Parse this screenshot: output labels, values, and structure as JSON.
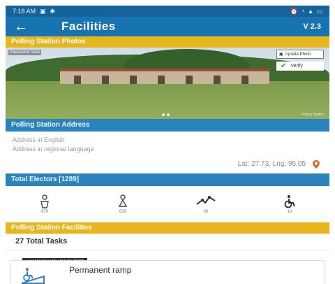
{
  "status_bar": {
    "time": "7:18 AM",
    "icons_left": [
      "sim-icon",
      "bluetooth-icon"
    ],
    "icons_right": [
      "alarm-icon",
      "wifi-icon",
      "signal-icon",
      "battery-icon"
    ]
  },
  "app_bar": {
    "back_icon": "arrow-left-icon",
    "title": "Facilities",
    "version": "V 2.3"
  },
  "sections": {
    "photos_header": "Polling Station Photos",
    "address_header": "Polling Station Address",
    "electors_header": "Total Electors [1289]",
    "facilities_header": "Polling Station Facilities"
  },
  "photo": {
    "view_label": "Panoramic View",
    "update_button": "Update Photo",
    "verify_button": "Verify",
    "caption": "Polling Station",
    "accent_colors": {
      "verify_check": "#2ea02e"
    }
  },
  "address": {
    "line1": "Address in English",
    "line2": "Address in regional language",
    "latlng": "Lat: 27.73, Lng: 95.05",
    "pin_icon": "map-pin-icon"
  },
  "electors": [
    {
      "icon": "male-icon",
      "count": "670"
    },
    {
      "icon": "female-icon",
      "count": "619"
    },
    {
      "icon": "third-gender-icon",
      "count": "00"
    },
    {
      "icon": "wheelchair-icon",
      "count": "10"
    }
  ],
  "tasks_text": "27 Total Tasks",
  "last_updated": "Last Updated On: [17-05-2023]",
  "facility_card": {
    "icon": "ramp-icon",
    "label": "Permanent ramp"
  },
  "colors": {
    "primary_blue": "#1874b0",
    "section_yellow": "#e6b61c",
    "section_blue": "#2a84bb"
  }
}
